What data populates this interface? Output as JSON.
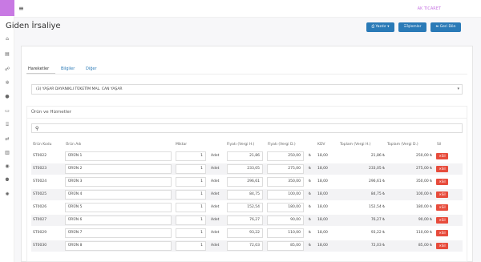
{
  "header": {
    "company": "AK TICARET"
  },
  "page": {
    "title": "Giden İrsaliye"
  },
  "toolbar": {
    "print_label": "Yazdır",
    "operations_label": "İşlemler",
    "back_label": "Geri Dön"
  },
  "tabs": [
    {
      "label": "Hareketler"
    },
    {
      "label": "Bilgiler"
    },
    {
      "label": "Diğer"
    }
  ],
  "customer": {
    "value": "(3) YAŞAR DAYANIKLI TÜKETİM MAL. CAN YAŞAR"
  },
  "section": {
    "title": "Ürün ve Hizmetler"
  },
  "table": {
    "headers": [
      "Ürün Kodu",
      "Ürün Adı",
      "Miktar",
      "Fiyatı (Vergi H.)",
      "Fiyatı (Vergi D.)",
      "KDV",
      "Toplam (Vergi H.)",
      "Toplam (Vergi D.)",
      "Sil"
    ],
    "rows": [
      {
        "code": "ST0022",
        "name": "ÜRÜN 1",
        "qty": "1",
        "unit": "Adet",
        "price_ex": "21,86",
        "price_in": "250,00",
        "kdv": "18,00",
        "total_ex": "21,86 ₺",
        "total_in": "250,00 ₺",
        "del": "Sil"
      },
      {
        "code": "ST0023",
        "name": "ÜRÜN 2",
        "qty": "1",
        "unit": "Adet",
        "price_ex": "233,05",
        "price_in": "275,00",
        "kdv": "18,00",
        "total_ex": "233,05 ₺",
        "total_in": "275,00 ₺",
        "del": "Sil"
      },
      {
        "code": "ST0024",
        "name": "ÜRÜN 3",
        "qty": "1",
        "unit": "Adet",
        "price_ex": "296,61",
        "price_in": "350,00",
        "kdv": "18,00",
        "total_ex": "296,61 ₺",
        "total_in": "350,00 ₺",
        "del": "Sil"
      },
      {
        "code": "ST0025",
        "name": "ÜRÜN 4",
        "qty": "1",
        "unit": "Adet",
        "price_ex": "84,75",
        "price_in": "100,00",
        "kdv": "18,00",
        "total_ex": "84,75 ₺",
        "total_in": "100,00 ₺",
        "del": "Sil"
      },
      {
        "code": "ST0026",
        "name": "ÜRÜN 5",
        "qty": "1",
        "unit": "Adet",
        "price_ex": "152,54",
        "price_in": "180,00",
        "kdv": "18,00",
        "total_ex": "152,54 ₺",
        "total_in": "180,00 ₺",
        "del": "Sil"
      },
      {
        "code": "ST0027",
        "name": "ÜRÜN 6",
        "qty": "1",
        "unit": "Adet",
        "price_ex": "76,27",
        "price_in": "90,00",
        "kdv": "18,00",
        "total_ex": "76,27 ₺",
        "total_in": "90,00 ₺",
        "del": "Sil"
      },
      {
        "code": "ST0029",
        "name": "ÜRÜN 7",
        "qty": "1",
        "unit": "Adet",
        "price_ex": "93,22",
        "price_in": "110,00",
        "kdv": "18,00",
        "total_ex": "93,22 ₺",
        "total_in": "110,00 ₺",
        "del": "Sil"
      },
      {
        "code": "ST0030",
        "name": "ÜRÜN 8",
        "qty": "1",
        "unit": "Adet",
        "price_ex": "72,03",
        "price_in": "85,00",
        "kdv": "18,00",
        "total_ex": "72,03 ₺",
        "total_in": "85,00 ₺",
        "del": "Sil"
      }
    ]
  },
  "icons": {
    "sidebar": [
      "home-icon",
      "file-icon",
      "users-icon",
      "gear-icon",
      "circle-icon",
      "money-icon",
      "bank-icon",
      "exchange-icon",
      "chart-icon",
      "user-icon",
      "group-icon",
      "settings-icon"
    ]
  },
  "colors": {
    "brand": "#c879e3",
    "primary": "#2a7ab7",
    "danger": "#e74c3c"
  }
}
